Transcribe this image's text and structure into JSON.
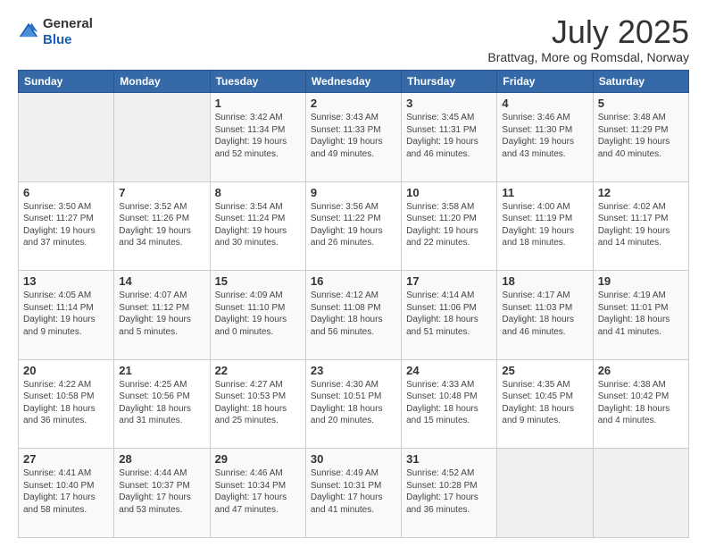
{
  "header": {
    "logo": {
      "general": "General",
      "blue": "Blue"
    },
    "title": "July 2025",
    "location": "Brattvag, More og Romsdal, Norway"
  },
  "weekdays": [
    "Sunday",
    "Monday",
    "Tuesday",
    "Wednesday",
    "Thursday",
    "Friday",
    "Saturday"
  ],
  "weeks": [
    [
      {
        "day": "",
        "info": ""
      },
      {
        "day": "",
        "info": ""
      },
      {
        "day": "1",
        "info": "Sunrise: 3:42 AM\nSunset: 11:34 PM\nDaylight: 19 hours\nand 52 minutes."
      },
      {
        "day": "2",
        "info": "Sunrise: 3:43 AM\nSunset: 11:33 PM\nDaylight: 19 hours\nand 49 minutes."
      },
      {
        "day": "3",
        "info": "Sunrise: 3:45 AM\nSunset: 11:31 PM\nDaylight: 19 hours\nand 46 minutes."
      },
      {
        "day": "4",
        "info": "Sunrise: 3:46 AM\nSunset: 11:30 PM\nDaylight: 19 hours\nand 43 minutes."
      },
      {
        "day": "5",
        "info": "Sunrise: 3:48 AM\nSunset: 11:29 PM\nDaylight: 19 hours\nand 40 minutes."
      }
    ],
    [
      {
        "day": "6",
        "info": "Sunrise: 3:50 AM\nSunset: 11:27 PM\nDaylight: 19 hours\nand 37 minutes."
      },
      {
        "day": "7",
        "info": "Sunrise: 3:52 AM\nSunset: 11:26 PM\nDaylight: 19 hours\nand 34 minutes."
      },
      {
        "day": "8",
        "info": "Sunrise: 3:54 AM\nSunset: 11:24 PM\nDaylight: 19 hours\nand 30 minutes."
      },
      {
        "day": "9",
        "info": "Sunrise: 3:56 AM\nSunset: 11:22 PM\nDaylight: 19 hours\nand 26 minutes."
      },
      {
        "day": "10",
        "info": "Sunrise: 3:58 AM\nSunset: 11:20 PM\nDaylight: 19 hours\nand 22 minutes."
      },
      {
        "day": "11",
        "info": "Sunrise: 4:00 AM\nSunset: 11:19 PM\nDaylight: 19 hours\nand 18 minutes."
      },
      {
        "day": "12",
        "info": "Sunrise: 4:02 AM\nSunset: 11:17 PM\nDaylight: 19 hours\nand 14 minutes."
      }
    ],
    [
      {
        "day": "13",
        "info": "Sunrise: 4:05 AM\nSunset: 11:14 PM\nDaylight: 19 hours\nand 9 minutes."
      },
      {
        "day": "14",
        "info": "Sunrise: 4:07 AM\nSunset: 11:12 PM\nDaylight: 19 hours\nand 5 minutes."
      },
      {
        "day": "15",
        "info": "Sunrise: 4:09 AM\nSunset: 11:10 PM\nDaylight: 19 hours\nand 0 minutes."
      },
      {
        "day": "16",
        "info": "Sunrise: 4:12 AM\nSunset: 11:08 PM\nDaylight: 18 hours\nand 56 minutes."
      },
      {
        "day": "17",
        "info": "Sunrise: 4:14 AM\nSunset: 11:06 PM\nDaylight: 18 hours\nand 51 minutes."
      },
      {
        "day": "18",
        "info": "Sunrise: 4:17 AM\nSunset: 11:03 PM\nDaylight: 18 hours\nand 46 minutes."
      },
      {
        "day": "19",
        "info": "Sunrise: 4:19 AM\nSunset: 11:01 PM\nDaylight: 18 hours\nand 41 minutes."
      }
    ],
    [
      {
        "day": "20",
        "info": "Sunrise: 4:22 AM\nSunset: 10:58 PM\nDaylight: 18 hours\nand 36 minutes."
      },
      {
        "day": "21",
        "info": "Sunrise: 4:25 AM\nSunset: 10:56 PM\nDaylight: 18 hours\nand 31 minutes."
      },
      {
        "day": "22",
        "info": "Sunrise: 4:27 AM\nSunset: 10:53 PM\nDaylight: 18 hours\nand 25 minutes."
      },
      {
        "day": "23",
        "info": "Sunrise: 4:30 AM\nSunset: 10:51 PM\nDaylight: 18 hours\nand 20 minutes."
      },
      {
        "day": "24",
        "info": "Sunrise: 4:33 AM\nSunset: 10:48 PM\nDaylight: 18 hours\nand 15 minutes."
      },
      {
        "day": "25",
        "info": "Sunrise: 4:35 AM\nSunset: 10:45 PM\nDaylight: 18 hours\nand 9 minutes."
      },
      {
        "day": "26",
        "info": "Sunrise: 4:38 AM\nSunset: 10:42 PM\nDaylight: 18 hours\nand 4 minutes."
      }
    ],
    [
      {
        "day": "27",
        "info": "Sunrise: 4:41 AM\nSunset: 10:40 PM\nDaylight: 17 hours\nand 58 minutes."
      },
      {
        "day": "28",
        "info": "Sunrise: 4:44 AM\nSunset: 10:37 PM\nDaylight: 17 hours\nand 53 minutes."
      },
      {
        "day": "29",
        "info": "Sunrise: 4:46 AM\nSunset: 10:34 PM\nDaylight: 17 hours\nand 47 minutes."
      },
      {
        "day": "30",
        "info": "Sunrise: 4:49 AM\nSunset: 10:31 PM\nDaylight: 17 hours\nand 41 minutes."
      },
      {
        "day": "31",
        "info": "Sunrise: 4:52 AM\nSunset: 10:28 PM\nDaylight: 17 hours\nand 36 minutes."
      },
      {
        "day": "",
        "info": ""
      },
      {
        "day": "",
        "info": ""
      }
    ]
  ]
}
